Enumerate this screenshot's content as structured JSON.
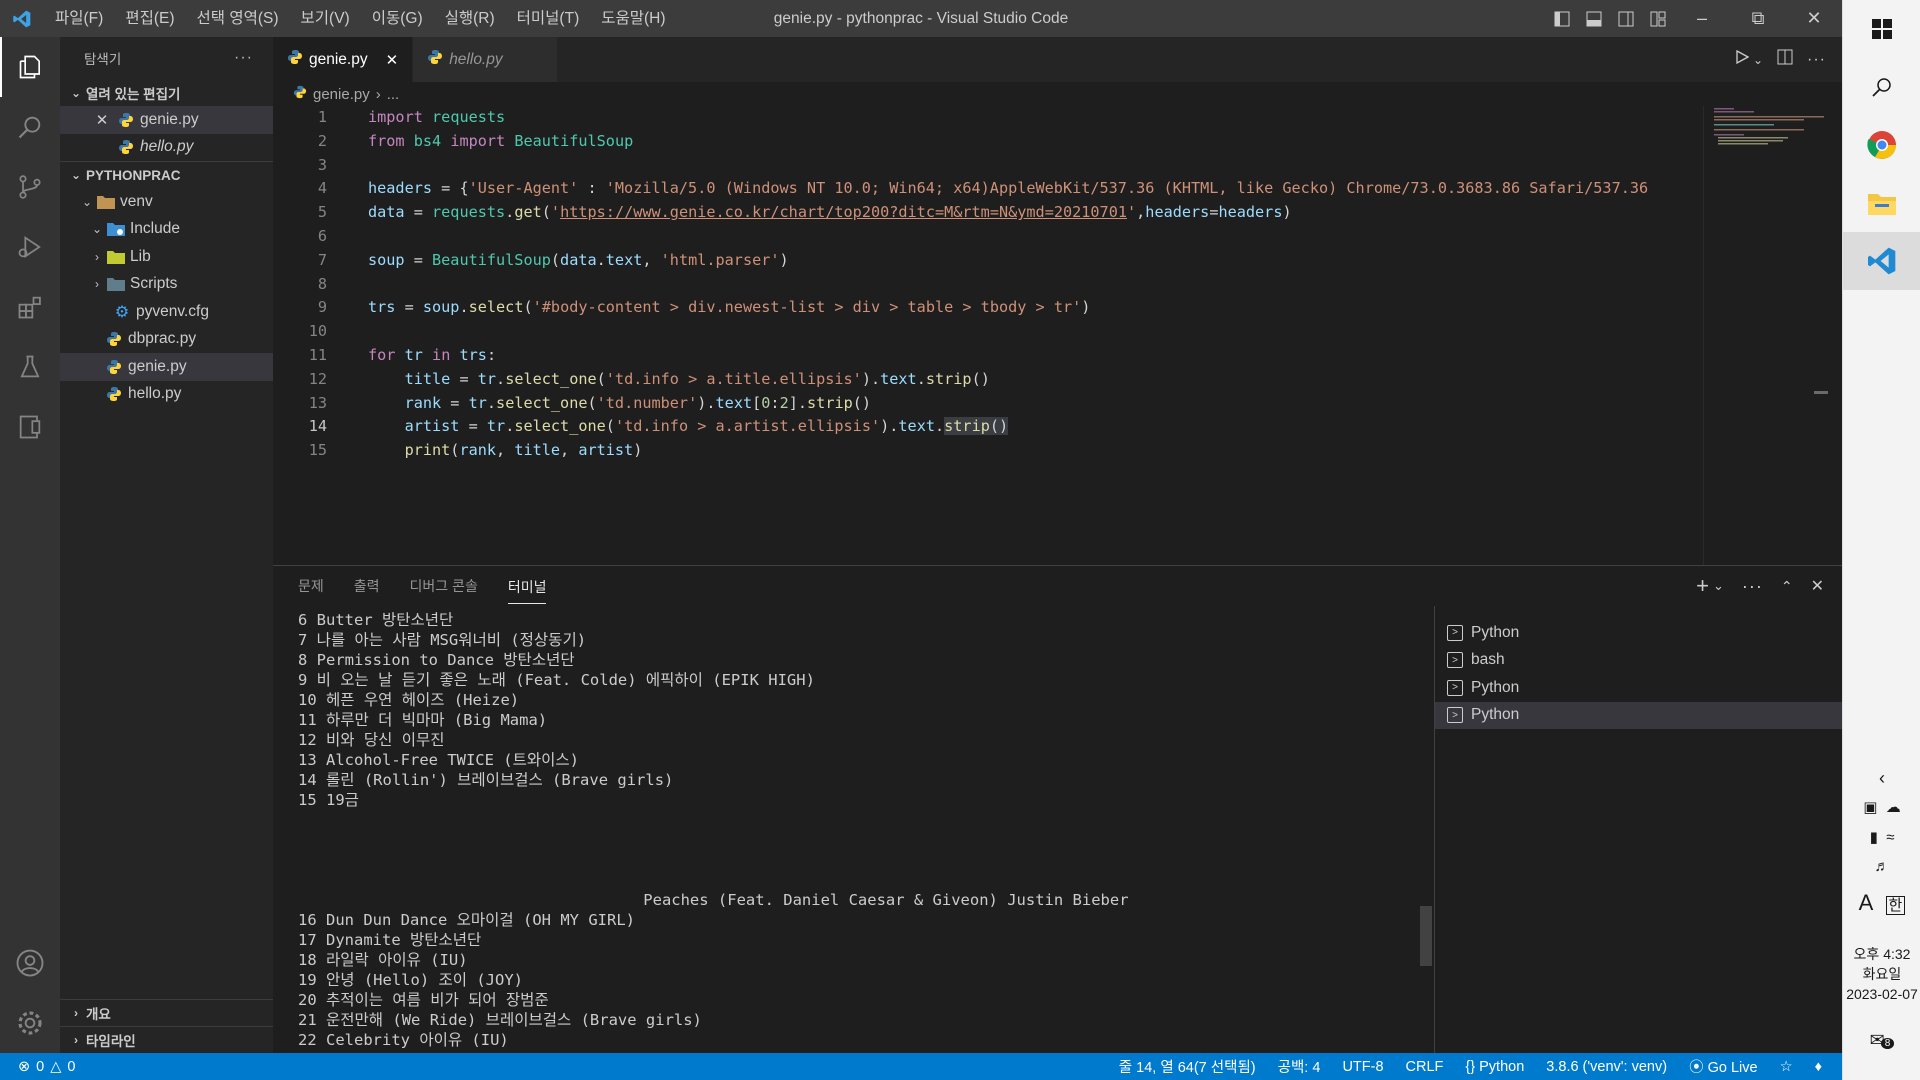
{
  "titlebar": {
    "menu": [
      "파일(F)",
      "편집(E)",
      "선택 영역(S)",
      "보기(V)",
      "이동(G)",
      "실행(R)",
      "터미널(T)",
      "도움말(H)"
    ],
    "title": "genie.py - pythonprac - Visual Studio Code"
  },
  "sidebar": {
    "title": "탐색기",
    "open_editors_label": "열려 있는 편집기",
    "open_editors": [
      "genie.py",
      "hello.py"
    ],
    "workspace_label": "PYTHONPRAC",
    "tree": {
      "venv": "venv",
      "include": "Include",
      "lib": "Lib",
      "scripts": "Scripts",
      "pyvenv": "pyvenv.cfg",
      "dbprac": "dbprac.py",
      "genie": "genie.py",
      "hello": "hello.py"
    },
    "outline_label": "개요",
    "timeline_label": "타임라인"
  },
  "editor": {
    "tabs": [
      "genie.py",
      "hello.py"
    ],
    "breadcrumb": [
      "genie.py",
      "..."
    ]
  },
  "panel": {
    "tabs": [
      "문제",
      "출력",
      "디버그 콘솔",
      "터미널"
    ],
    "terminal_lines": [
      "6 Butter 방탄소년단",
      "7 나를 아는 사람 MSG워너비 (정상동기)",
      "8 Permission to Dance 방탄소년단",
      "9 비 오는 날 듣기 좋은 노래 (Feat. Colde) 에픽하이 (EPIK HIGH)",
      "10 헤픈 우연 헤이즈 (Heize)",
      "11 하루만 더 빅마마 (Big Mama)",
      "12 비와 당신 이무진",
      "13 Alcohol-Free TWICE (트와이스)",
      "14 롤린 (Rollin') 브레이브걸스 (Brave girls)",
      "15 19금",
      "",
      "",
      "",
      "",
      "                                     Peaches (Feat. Daniel Caesar & Giveon) Justin Bieber",
      "16 Dun Dun Dance 오마이걸 (OH MY GIRL)",
      "17 Dynamite 방탄소년단",
      "18 라일락 아이유 (IU)",
      "19 안녕 (Hello) 조이 (JOY)",
      "20 추적이는 여름 비가 되어 장범준",
      "21 운전만해 (We Ride) 브레이브걸스 (Brave girls)",
      "22 Celebrity 아이유 (IU)"
    ],
    "terminals": [
      "Python",
      "bash",
      "Python",
      "Python"
    ]
  },
  "statusbar": {
    "errors": "0",
    "warnings": "0",
    "position": "줄 14, 열 64(7 선택됨)",
    "spaces": "공백: 4",
    "encoding": "UTF-8",
    "eol": "CRLF",
    "language": "Python",
    "interpreter": "3.8.6 ('venv': venv)",
    "golive": "Go Live"
  },
  "taskbar": {
    "time": "오후 4:32",
    "day": "화요일",
    "date": "2023-02-07",
    "ime": "한",
    "font_a": "A",
    "notif": "8"
  },
  "colors": {
    "accent": "#007acc",
    "keyword": "#c586c0",
    "string": "#ce9178",
    "function": "#dcdcaa",
    "class": "#4ec9b0",
    "variable": "#9cdcfe"
  }
}
